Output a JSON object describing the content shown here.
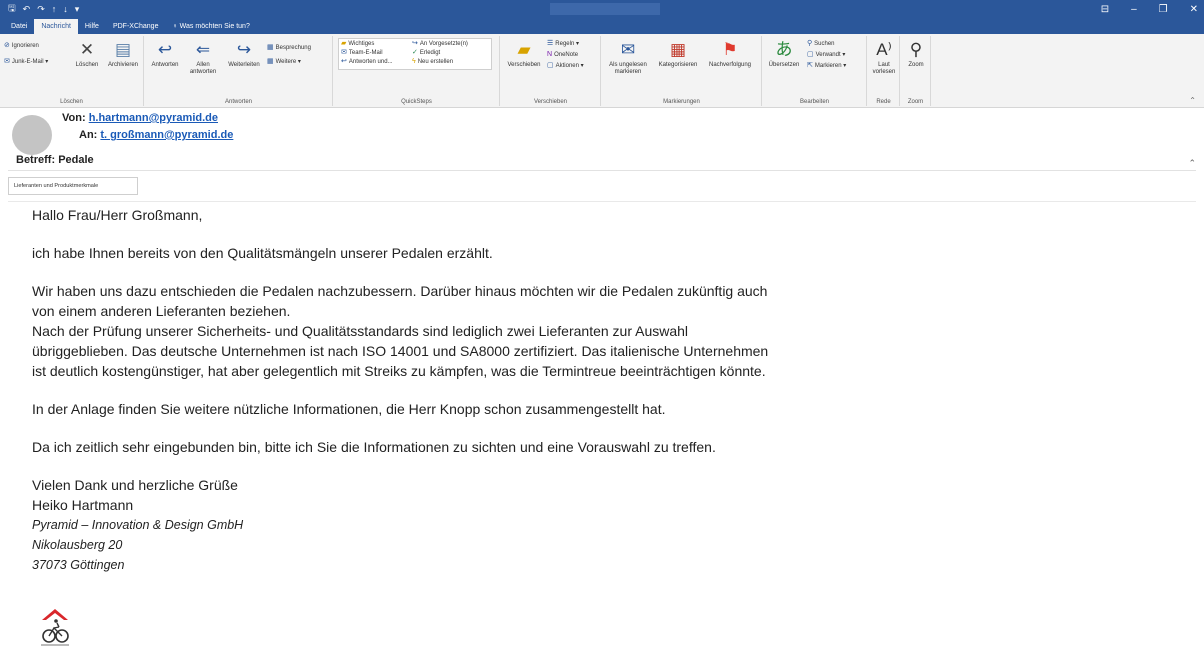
{
  "titlebar": {
    "qat_icons": [
      "save-icon",
      "undo-icon",
      "redo-icon",
      "up-icon",
      "down-icon",
      "customize-icon"
    ],
    "window_controls": [
      "⊟",
      "–",
      "❐",
      "✕"
    ]
  },
  "tabs": [
    "Datei",
    "Nachricht",
    "Hilfe",
    "PDF-XChange",
    "Was möchten Sie tun?"
  ],
  "ribbon": {
    "loeschen": {
      "label": "Löschen",
      "ignorieren": "Ignorieren",
      "junk": "Junk-E-Mail",
      "loeschen_btn": "Löschen",
      "archivieren": "Archivieren"
    },
    "antworten": {
      "label": "Antworten",
      "antworten_btn": "Antworten",
      "allen": "Allen antworten",
      "weiterleiten": "Weiterleiten",
      "besprechung": "Besprechung",
      "weitere": "Weitere"
    },
    "quicksteps": {
      "label": "QuickSteps",
      "items": [
        "Wichtiges",
        "Team-E-Mail",
        "Antworten und...",
        "An Vorgesetzte(n)",
        "Erledigt",
        "Neu erstellen"
      ]
    },
    "verschieben": {
      "label": "Verschieben",
      "verschieben_btn": "Verschieben",
      "regeln": "Regeln",
      "onenote": "OneNote",
      "aktionen": "Aktionen"
    },
    "markierungen": {
      "label": "Markierungen",
      "ungelesen": "Als ungelesen markieren",
      "kategorisieren": "Kategorisieren",
      "nachverfolgung": "Nachverfolgung"
    },
    "bearbeiten": {
      "label": "Bearbeiten",
      "uebersetzen": "Übersetzen",
      "suchen": "Suchen",
      "verwandt": "Verwandt",
      "markieren": "Markieren"
    },
    "rede": {
      "label": "Rede",
      "laut": "Laut vorlesen"
    },
    "zoom": {
      "label": "Zoom",
      "zoom_btn": "Zoom"
    }
  },
  "header": {
    "von_label": "Von:",
    "von": "h.hartmann@pyramid.de",
    "an_label": "An:",
    "an": "t. großmann@pyramid.de",
    "betreff_label": "Betreff:",
    "betreff": "Pedale",
    "attachment": "Lieferanten und Produktmerkmale"
  },
  "body": {
    "greeting": "Hallo Frau/Herr Großmann,",
    "p1": "ich habe Ihnen bereits von den Qualitätsmängeln unserer Pedalen erzählt.",
    "p2_l1": "Wir haben uns dazu entschieden die Pedalen nachzubessern. Darüber hinaus möchten wir die Pedalen zukünftig auch",
    "p2_l2": "von einem anderen Lieferanten beziehen.",
    "p2_l3": "Nach der Prüfung unserer Sicherheits- und Qualitätsstandards sind lediglich zwei Lieferanten zur Auswahl",
    "p2_l4": "übriggeblieben. Das deutsche Unternehmen ist nach ISO 14001 und SA8000 zertifiziert. Das italienische Unternehmen",
    "p2_l5": "ist deutlich kostengünstiger, hat aber gelegentlich mit Streiks zu kämpfen, was die Termintreue beeinträchtigen könnte.",
    "p3": "In der Anlage finden Sie weitere nützliche Informationen, die Herr Knopp schon zusammengestellt hat.",
    "p4": "Da ich zeitlich sehr eingebunden bin, bitte ich Sie die Informationen zu sichten und eine Vorauswahl zu treffen.",
    "closing": "Vielen Dank und herzliche Grüße",
    "name": "Heiko Hartmann",
    "company": "Pyramid – Innovation & Design GmbH",
    "street": "Nikolausberg 20",
    "city": "37073 Göttingen"
  },
  "colors": {
    "accent": "#2b579a",
    "link": "#1a5ab7",
    "ribbon_bg": "#f3f3f3",
    "logo_red": "#d9262b"
  }
}
